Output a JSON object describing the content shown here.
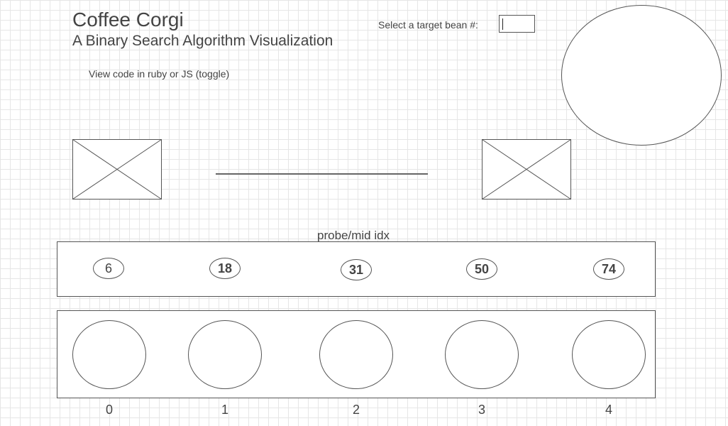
{
  "header": {
    "title": "Coffee Corgi",
    "subtitle": "A Binary Search Algorithm Visualization",
    "toggle_link": "View code in ruby or JS (toggle)"
  },
  "target": {
    "label": "Select a target bean #:",
    "value": ""
  },
  "probe_label": "probe/mid idx",
  "values": [
    {
      "text": "6",
      "bold": false
    },
    {
      "text": "18",
      "bold": true
    },
    {
      "text": "31",
      "bold": true
    },
    {
      "text": "50",
      "bold": true
    },
    {
      "text": "74",
      "bold": true
    }
  ],
  "indices": [
    "0",
    "1",
    "2",
    "3",
    "4"
  ]
}
